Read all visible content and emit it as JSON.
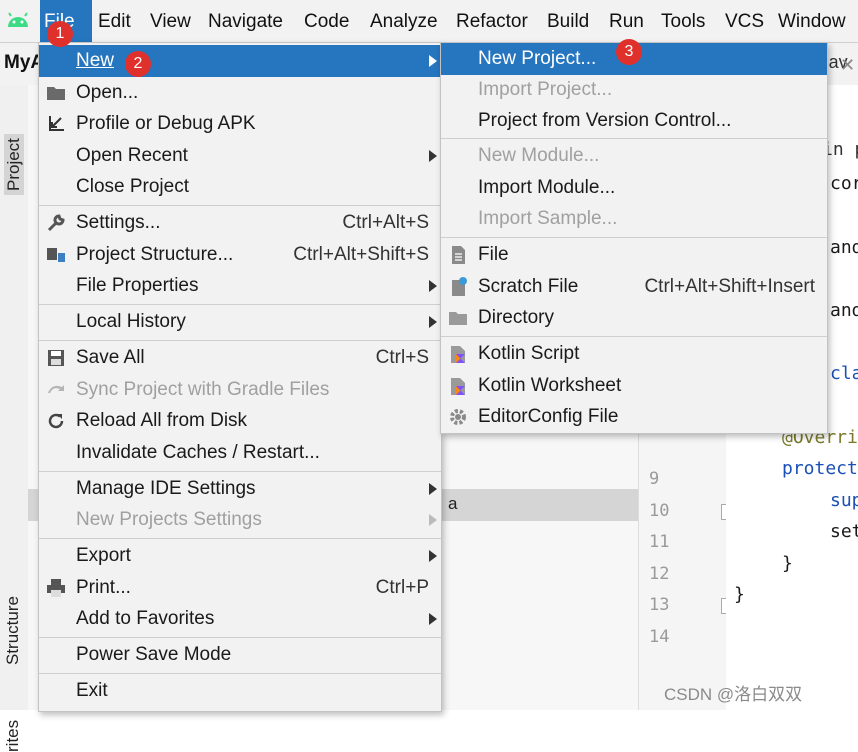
{
  "menubar": {
    "items": [
      "File",
      "Edit",
      "View",
      "Navigate",
      "Code",
      "Analyze",
      "Refactor",
      "Build",
      "Run",
      "Tools",
      "VCS",
      "Window"
    ]
  },
  "ide": {
    "project_name": "MyA",
    "file_tab": "v.jav",
    "side_tabs": [
      "Project",
      "Structure",
      "rites"
    ],
    "selected_row_text": "a",
    "line_numbers": [
      "9",
      "10",
      "11",
      "12",
      "13",
      "14"
    ],
    "code_fragments": [
      "in p",
      "cor",
      "andr",
      "andr",
      "clas",
      "@Overri",
      "protect",
      "sup",
      "set",
      "}",
      "}"
    ],
    "watermark": "CSDN @洛白双双"
  },
  "file_menu": {
    "items": [
      {
        "label": "New",
        "arrow": true
      },
      {
        "label": "Open..."
      },
      {
        "label": "Profile or Debug APK"
      },
      {
        "label": "Open Recent",
        "arrow": true
      },
      {
        "label": "Close Project"
      },
      {
        "label": "Settings...",
        "shortcut": "Ctrl+Alt+S"
      },
      {
        "label": "Project Structure...",
        "shortcut": "Ctrl+Alt+Shift+S"
      },
      {
        "label": "File Properties",
        "arrow": true
      },
      {
        "label": "Local History",
        "arrow": true
      },
      {
        "label": "Save All",
        "shortcut": "Ctrl+S"
      },
      {
        "label": "Sync Project with Gradle Files",
        "disabled": true
      },
      {
        "label": "Reload All from Disk"
      },
      {
        "label": "Invalidate Caches / Restart..."
      },
      {
        "label": "Manage IDE Settings",
        "arrow": true
      },
      {
        "label": "New Projects Settings",
        "arrow": true,
        "disabled": true
      },
      {
        "label": "Export",
        "arrow": true
      },
      {
        "label": "Print...",
        "shortcut": "Ctrl+P"
      },
      {
        "label": "Add to Favorites",
        "arrow": true
      },
      {
        "label": "Power Save Mode"
      },
      {
        "label": "Exit"
      }
    ]
  },
  "new_submenu": {
    "items": [
      {
        "label": "New Project..."
      },
      {
        "label": "Import Project...",
        "disabled": true
      },
      {
        "label": "Project from Version Control..."
      },
      {
        "label": "New Module...",
        "disabled": true
      },
      {
        "label": "Import Module..."
      },
      {
        "label": "Import Sample...",
        "disabled": true
      },
      {
        "label": "File"
      },
      {
        "label": "Scratch File",
        "shortcut": "Ctrl+Alt+Shift+Insert"
      },
      {
        "label": "Directory"
      },
      {
        "label": "Kotlin Script"
      },
      {
        "label": "Kotlin Worksheet"
      },
      {
        "label": "EditorConfig File"
      }
    ]
  },
  "badges": [
    "1",
    "2",
    "3"
  ],
  "colors": {
    "selection": "#2675bf",
    "badge": "#e0302c",
    "android_green": "#3ddc84",
    "kotlin": "#7f52ff"
  },
  "icons": {
    "app": "android-icon",
    "open": "folder-icon",
    "profile": "profile-apk-icon",
    "settings": "wrench-icon",
    "structure": "project-structure-icon",
    "save": "floppy-disk-icon",
    "sync": "gradle-sync-icon",
    "reload": "reload-icon",
    "print": "printer-icon",
    "file": "file-icon",
    "scratch": "scratch-file-icon",
    "directory": "folder-icon",
    "kotlin": "kotlin-icon",
    "editorconfig": "gear-icon"
  }
}
